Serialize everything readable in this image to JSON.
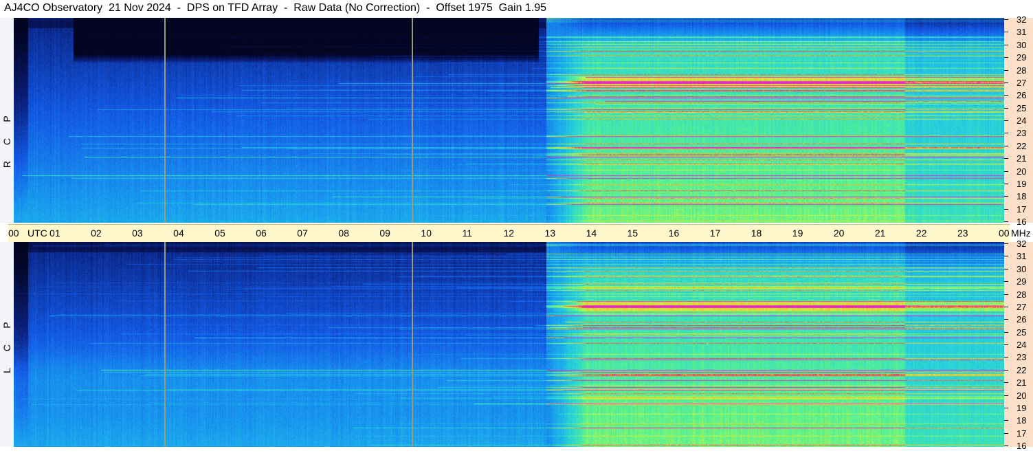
{
  "title": "AJ4CO Observatory  21 Nov 2024  -  DPS on TFD Array  -  Raw Data (No Correction)  -  Offset 1975  Gain 1.95",
  "colors": {
    "background_low": "#0a1a5c",
    "marker_line": "#9c9c78",
    "axis_band": "#fff8cc",
    "freq_axis_bg": "#fde0c9"
  },
  "chart_data": [
    {
      "type": "heatmap",
      "polarization": [
        "R",
        "C",
        "P"
      ],
      "x_ticks": [
        "00",
        "01",
        "02",
        "03",
        "04",
        "05",
        "06",
        "07",
        "08",
        "09",
        "10",
        "11",
        "12",
        "13",
        "14",
        "15",
        "16",
        "17",
        "18",
        "19",
        "20",
        "21",
        "22",
        "23",
        "00"
      ],
      "x_unit": "UTC",
      "y_ticks": [
        16,
        17,
        18,
        19,
        20,
        21,
        22,
        23,
        24,
        25,
        26,
        27,
        28,
        29,
        30,
        31,
        32
      ],
      "y_unit": "MHz",
      "ylim": [
        16,
        32
      ],
      "xlim": [
        0,
        24
      ],
      "marker_times": [
        3.65,
        9.65
      ],
      "daytime_start": 12.9,
      "strong_band_mhz": 27
    },
    {
      "type": "heatmap",
      "polarization": [
        "L",
        "C",
        "P"
      ],
      "x_ticks": [
        "00",
        "01",
        "02",
        "03",
        "04",
        "05",
        "06",
        "07",
        "08",
        "09",
        "10",
        "11",
        "12",
        "13",
        "14",
        "15",
        "16",
        "17",
        "18",
        "19",
        "20",
        "21",
        "22",
        "23",
        "00"
      ],
      "x_unit": "UTC",
      "y_ticks": [
        16,
        17,
        18,
        19,
        20,
        21,
        22,
        23,
        24,
        25,
        26,
        27,
        28,
        29,
        30,
        31,
        32
      ],
      "y_unit": "MHz",
      "ylim": [
        16,
        32
      ],
      "xlim": [
        0,
        24
      ],
      "marker_times": [
        3.65,
        9.65
      ],
      "daytime_start": 12.9,
      "strong_band_mhz": 27
    }
  ]
}
